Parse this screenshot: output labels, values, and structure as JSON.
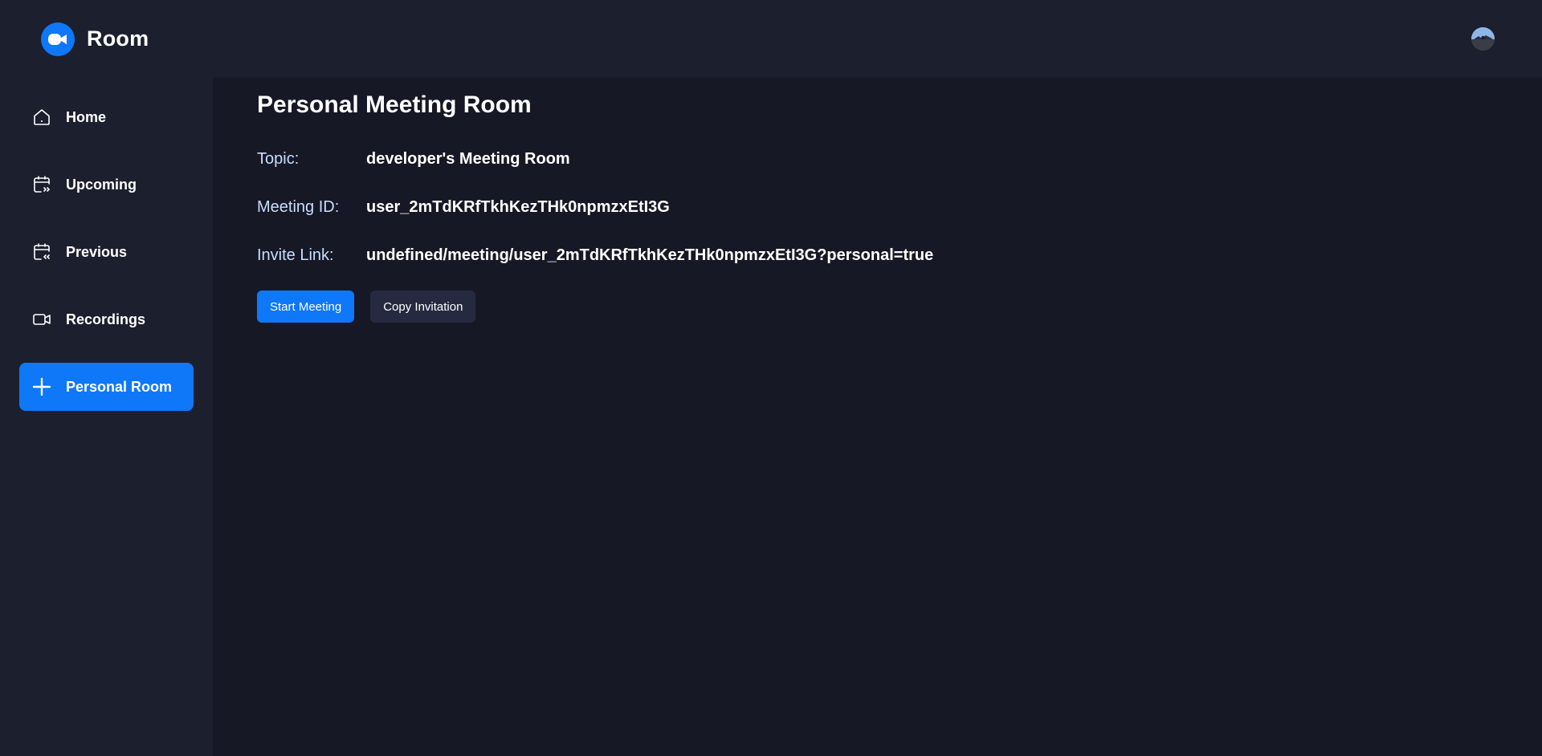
{
  "app": {
    "name": "Room"
  },
  "colors": {
    "accent": "#0e78f9",
    "sidebar_bg": "#1c1f2e",
    "main_bg": "#161925",
    "dark_button": "#252a41",
    "label_color": "#c9ddff"
  },
  "sidebar": {
    "items": [
      {
        "label": "Home",
        "icon": "home-icon"
      },
      {
        "label": "Upcoming",
        "icon": "calendar-upcoming-icon"
      },
      {
        "label": "Previous",
        "icon": "calendar-previous-icon"
      },
      {
        "label": "Recordings",
        "icon": "video-icon"
      },
      {
        "label": "Personal Room",
        "icon": "plus-icon",
        "active": true
      }
    ]
  },
  "main": {
    "title": "Personal Meeting Room",
    "rows": [
      {
        "label": "Topic:",
        "value": "developer's Meeting Room"
      },
      {
        "label": "Meeting ID:",
        "value": "user_2mTdKRfTkhKezTHk0npmzxEtI3G"
      },
      {
        "label": "Invite Link:",
        "value": "undefined/meeting/user_2mTdKRfTkhKezTHk0npmzxEtI3G?personal=true"
      }
    ],
    "actions": {
      "start_label": "Start Meeting",
      "copy_label": "Copy Invitation"
    }
  }
}
